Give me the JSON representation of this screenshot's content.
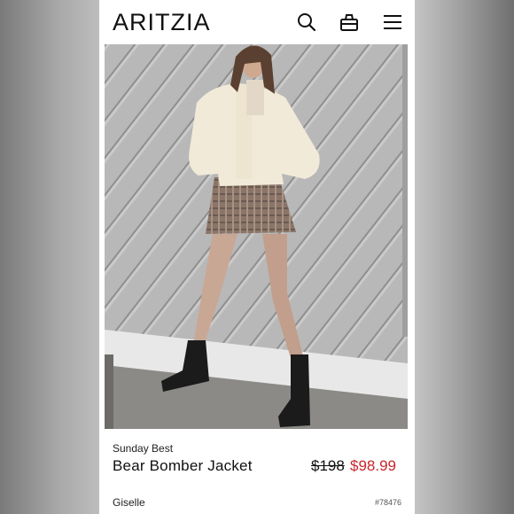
{
  "header": {
    "logo": "ARITZIA",
    "icons": [
      "search-icon",
      "shopping-bag-icon",
      "hamburger-menu-icon"
    ]
  },
  "product": {
    "brand": "Sunday Best",
    "name": "Bear Bomber Jacket",
    "original_price": "$198",
    "sale_price": "$98.99",
    "sale_color": "#c8262c",
    "seller_name": "Giselle",
    "sku": "#78476"
  }
}
